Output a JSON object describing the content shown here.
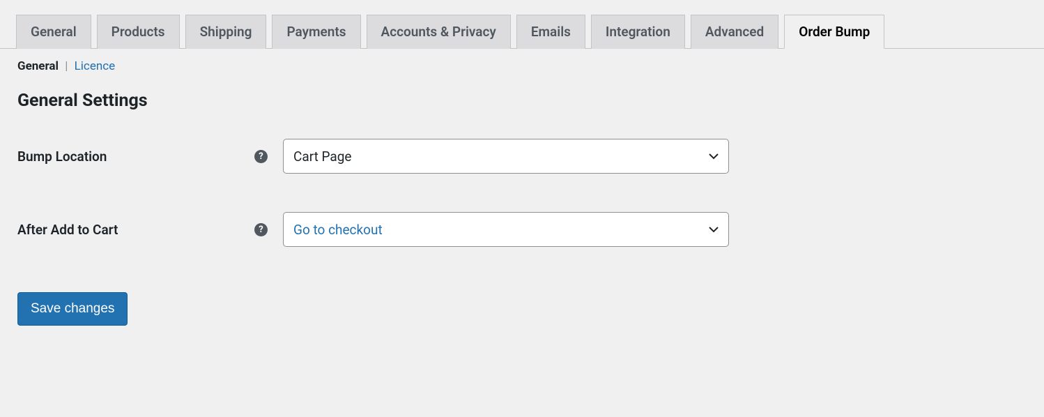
{
  "tabs": {
    "items": [
      {
        "label": "General"
      },
      {
        "label": "Products"
      },
      {
        "label": "Shipping"
      },
      {
        "label": "Payments"
      },
      {
        "label": "Accounts & Privacy"
      },
      {
        "label": "Emails"
      },
      {
        "label": "Integration"
      },
      {
        "label": "Advanced"
      },
      {
        "label": "Order Bump"
      }
    ]
  },
  "subnav": {
    "current": "General",
    "link": "Licence"
  },
  "heading": "General Settings",
  "fields": {
    "bump_location": {
      "label": "Bump Location",
      "value": "Cart Page"
    },
    "after_add_to_cart": {
      "label": "After Add to Cart",
      "value": "Go to checkout"
    }
  },
  "actions": {
    "save": "Save changes"
  }
}
